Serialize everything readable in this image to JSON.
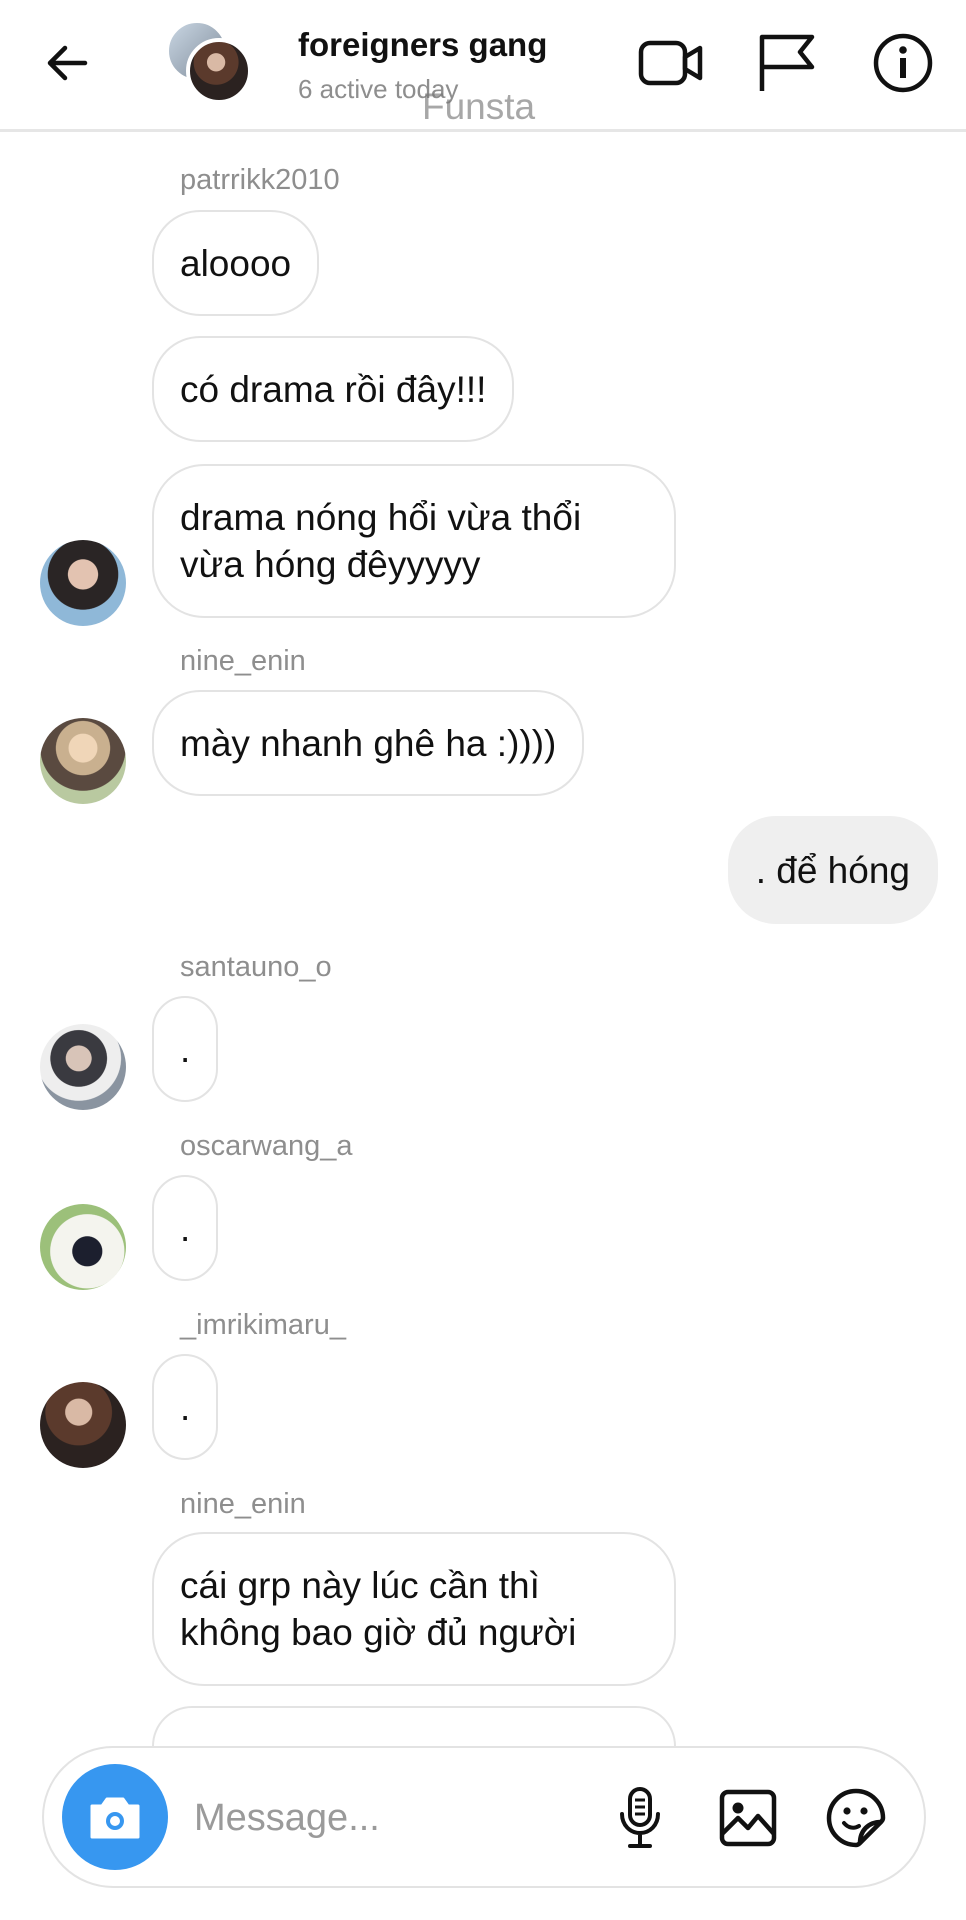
{
  "header": {
    "title": "foreigners gang",
    "subtitle": "6 active today",
    "watermark": "Funsta",
    "icons": [
      "back-arrow-icon",
      "video-camera-icon",
      "flag-icon",
      "info-icon"
    ]
  },
  "messages": [
    {
      "username": "patrrikk2010"
    },
    {
      "text": "aloooo"
    },
    {
      "text": "có drama rồi đây!!!"
    },
    {
      "text": "drama nóng hổi vừa thổi\nvừa hóng đêyyyyy"
    },
    {
      "username": "nine_enin"
    },
    {
      "text": "mày nhanh ghê ha :))))"
    },
    {
      "text": ". để hóng",
      "from_me": true
    },
    {
      "username": "santauno_o"
    },
    {
      "text": "."
    },
    {
      "username": "oscarwang_a"
    },
    {
      "text": "."
    },
    {
      "username": "_imrikimaru_"
    },
    {
      "text": "."
    },
    {
      "username": "nine_enin"
    },
    {
      "text": "cái grp này lúc cần thì\nkhông bao giờ đủ người"
    }
  ],
  "composer": {
    "placeholder": "Message...",
    "icons": [
      "camera-icon",
      "microphone-icon",
      "gallery-icon",
      "sticker-icon"
    ]
  },
  "colors": {
    "accent": "#3797f0",
    "own_bubble": "#efefef",
    "muted_text": "#8e8e8e",
    "border": "#e3e3e3"
  }
}
